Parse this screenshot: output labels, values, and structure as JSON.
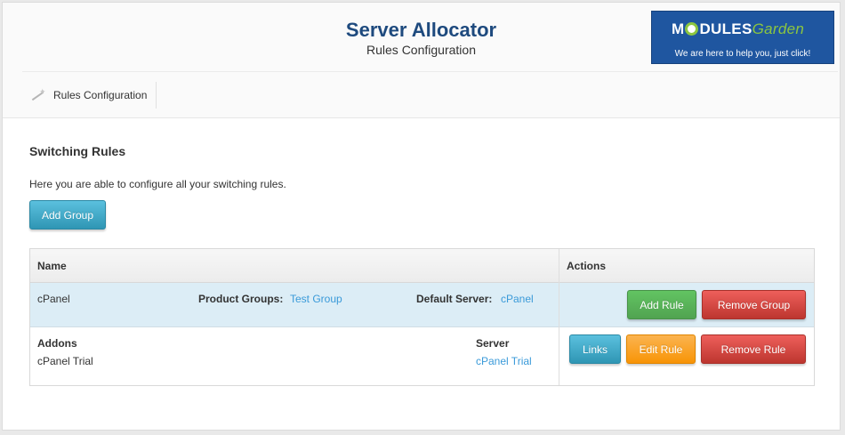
{
  "header": {
    "title": "Server Allocator",
    "subtitle": "Rules Configuration"
  },
  "logo": {
    "word_start": "M",
    "word_end": "DULES",
    "word_garden": "Garden",
    "tagline": "We are here to help you, just click!",
    "brand_color": "#1f56a0",
    "accent_color": "#8cc63f"
  },
  "nav": {
    "items": [
      {
        "label": "Rules Configuration",
        "icon": "magic-wand-icon"
      }
    ]
  },
  "section": {
    "title": "Switching Rules",
    "description": "Here you are able to configure all your switching rules.",
    "add_group_label": "Add Group"
  },
  "table": {
    "columns": [
      "Name",
      "Actions"
    ],
    "group": {
      "name": "cPanel",
      "product_groups_label": "Product Groups:",
      "product_groups_value": "Test Group",
      "default_server_label": "Default Server:",
      "default_server_value": "cPanel",
      "add_rule_label": "Add Rule",
      "remove_group_label": "Remove Group"
    },
    "rule": {
      "addons_label": "Addons",
      "addons_value": "cPanel Trial",
      "server_label": "Server",
      "server_value": "cPanel Trial",
      "links_label": "Links",
      "edit_rule_label": "Edit Rule",
      "remove_rule_label": "Remove Rule"
    }
  }
}
